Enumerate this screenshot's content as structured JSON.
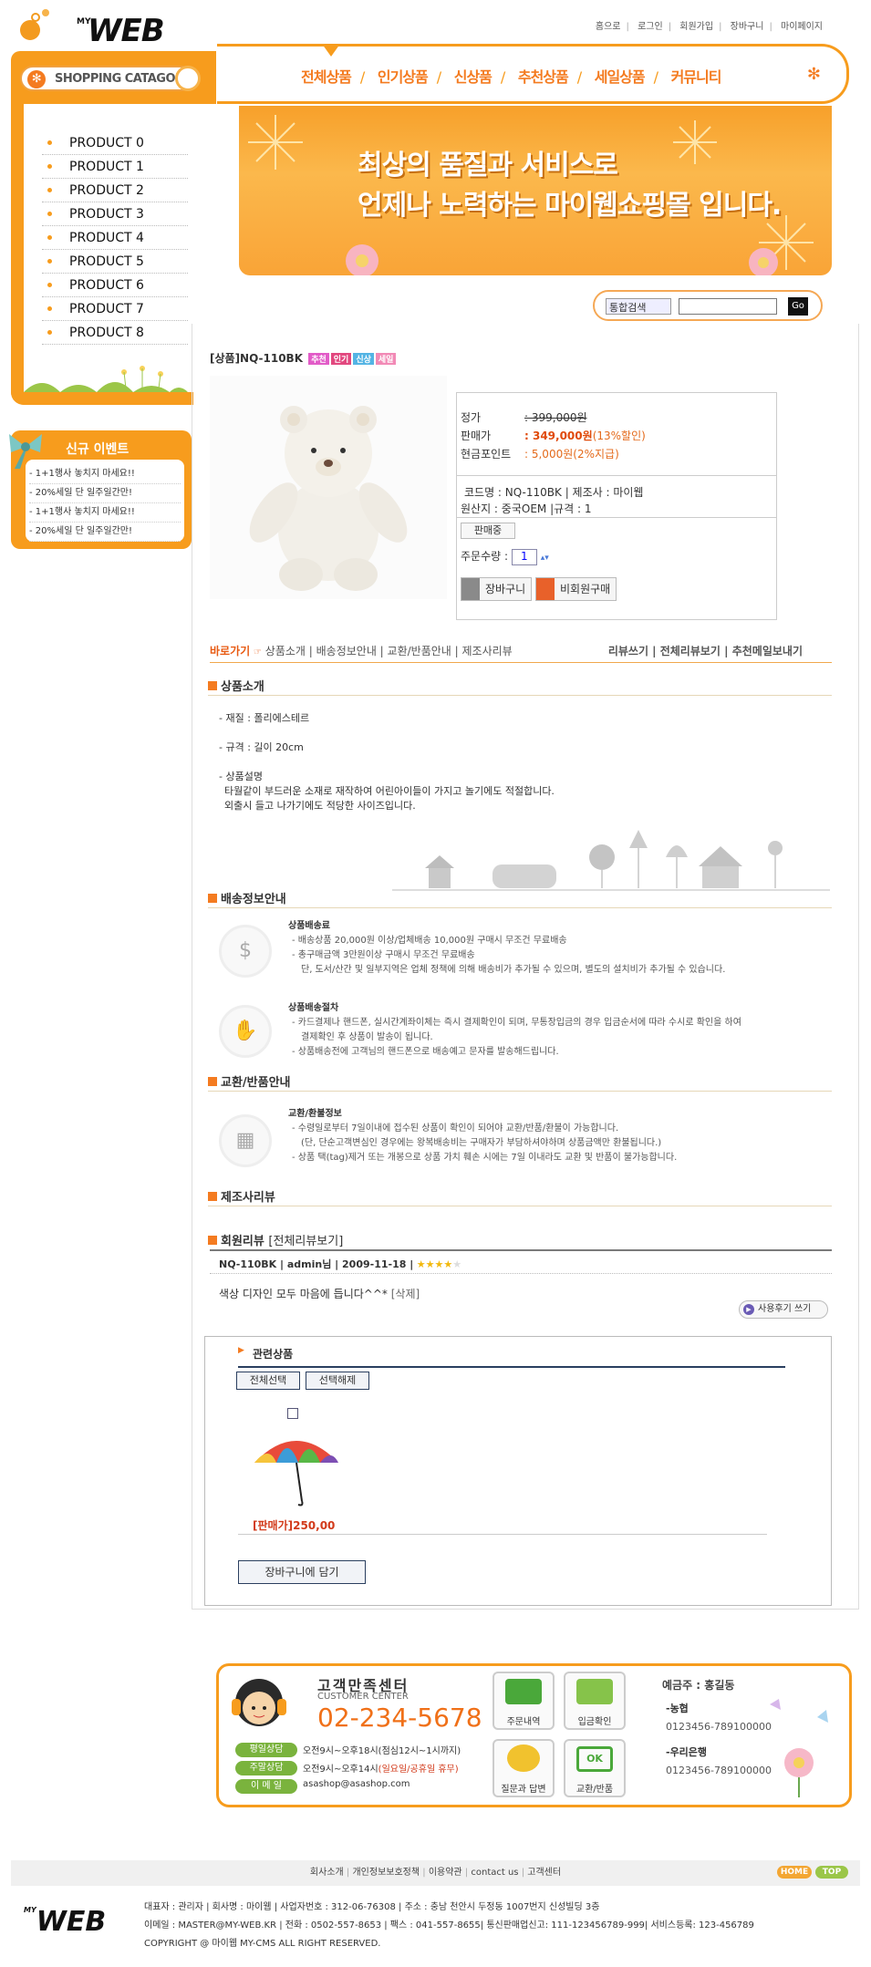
{
  "header": {
    "logo_my": "MY",
    "logo_text": "WEB",
    "top_links": [
      "홈으로",
      "로그인",
      "회원가입",
      "장바구니",
      "마이페이지"
    ]
  },
  "category": {
    "title": "SHOPPING CATAGORY",
    "items": [
      "PRODUCT 0",
      "PRODUCT 1",
      "PRODUCT 2",
      "PRODUCT 3",
      "PRODUCT 4",
      "PRODUCT 5",
      "PRODUCT 6",
      "PRODUCT 7",
      "PRODUCT 8"
    ]
  },
  "menu": [
    "전체상품",
    "인기상품",
    "신상품",
    "추천상품",
    "세일상품",
    "커뮤니티"
  ],
  "banner": {
    "line1": "최상의 품질과 서비스로",
    "line2": "언제나 노력하는 마이웹쇼핑몰 입니다."
  },
  "events": {
    "title": "신규 이벤트",
    "items": [
      "- 1+1행사 놓치지 마세요!!",
      "- 20%세일 단 일주일간만!",
      "- 1+1행사 놓치지 마세요!!",
      "- 20%세일 단 일주일간만!"
    ]
  },
  "search": {
    "select": "통합검색",
    "button": "Go"
  },
  "product": {
    "title": "[상품]NQ-110BK",
    "badges": [
      "추천",
      "인기",
      "신상",
      "세일"
    ],
    "price_label": "정가",
    "price": ": 399,000원",
    "sale_label": "판매가",
    "sale_price": ": 349,000원",
    "sale_pct": "(13%할인)",
    "point_label": "현금포인트",
    "point": ": 5,000원",
    "point_pct": "(2%지급)",
    "code_line": "코드명 : NQ-110BK | 제조사 : 마이웹",
    "origin_line": "원산지 : 중국OEM |규격 : 1",
    "status": "판매중",
    "qty_label": "주문수량 :",
    "qty": "1",
    "cart_btn": "장바구니",
    "buy_btn": "비회원구매"
  },
  "tabs": {
    "go": "바로가기",
    "left": "상품소개 | 배송정보안내 | 교환/반품안내 | 제조사리뷰",
    "right": "리뷰쓰기 | 전체리뷰보기 | 추천메일보내기"
  },
  "intro": {
    "head": "상품소개",
    "material": "- 재질 : 폴리에스테르",
    "size": "- 규격 : 길이 20cm",
    "desc_label": "- 상품설명",
    "desc1": "타월같이 부드러운 소재로 재작하여 어린아이들이 가지고 놀기에도 적절합니다.",
    "desc2": "외출시 들고 나가기에도 적당한 사이즈입니다."
  },
  "shipping": {
    "head": "배송정보안내",
    "fee_title": "상품배송료",
    "fee1": "- 배송상품 20,000원 이상/업체배송 10,000원 구매시 무조건 무료배송",
    "fee2": "- 총구매금액 3만원이상 구매시 무조건 무료배송",
    "fee3": "단, 도서/산간 및 일부지역은 업체 정책에 의해 배송비가 추가될 수 있으며, 별도의 설치비가 추가될 수 있습니다.",
    "proc_title": "상품배송절차",
    "proc1": "- 카드결제나 핸드폰, 실시간계좌이체는 즉시 결제확인이 되며, 무통장입금의 경우 입금순서에 따라 수시로 확인을 하여",
    "proc2": "결제확인 후 상품이 발송이 됩니다.",
    "proc3": "- 상품배송전에 고객님의 핸드폰으로 배송예고 문자를 발송해드립니다."
  },
  "exchange": {
    "head": "교환/반품안내",
    "title": "교환/환불정보",
    "l1": "- 수령일로부터 7일이내에 접수된 상품이 확인이 되어야 교환/반품/환불이 가능합니다.",
    "l2": "(단, 단순고객변심인 경우에는 왕복배송비는 구매자가 부담하셔야하며 상품금액만 환불됩니다.)",
    "l3": "- 상품 택(tag)제거 또는 개봉으로 상품 가치 훼손 시에는 7일 이내라도 교환 및 반품이 불가능합니다."
  },
  "maker_review": {
    "head": "제조사리뷰"
  },
  "member_review": {
    "head": "회원리뷰",
    "all": "[전체리뷰보기]",
    "meta": "NQ-110BK | admin님 | 2009-11-18 |",
    "stars_filled": 4,
    "stars_total": 5,
    "text": "색상 디자인 모두 마음에 듭니다^^*",
    "delete": "[삭제]",
    "write_btn": "사용후기 쓰기"
  },
  "related": {
    "head": "관련상품",
    "select_all": "전체선택",
    "deselect": "선택해제",
    "price": "[판매가]250,00",
    "cart_btn": "장바구니에 담기"
  },
  "cs": {
    "title": "고객만족센터",
    "sub": "CUSTOMER CENTER",
    "phone": "02-234-5678",
    "weekday_label": "평일상담",
    "weekday": "오전9시~오후18시(점심12시~1시까지)",
    "weekend_label": "주말상담",
    "weekend": "오전9시~오후14시",
    "weekend_note": "(일요일/공휴일 휴무)",
    "email_label": "이 메 일",
    "email": "asashop@asashop.com",
    "tiles": [
      "주문내역",
      "입금확인",
      "질문과 답변",
      "교환/반품"
    ],
    "bank_title": "예금주 : 홍길동",
    "bank1": "-농협",
    "acct1": "0123456-789100000",
    "bank2": "-우리은행",
    "acct2": "0123456-789100000"
  },
  "footer": {
    "links": [
      "회사소개",
      "개인정보보호정책",
      "이용약관",
      "contact us",
      "고객센터"
    ],
    "home": "HOME",
    "top": "TOP",
    "line1": "대표자 : 관리자 | 회사명 : 마이웹 | 사업자번호 : 312-06-76308 | 주소 : 충남 천안시 두정동 1007번지 신성빌딩 3층",
    "line2": "이메일 : MASTER@MY-WEB.KR | 전화 : 0502-557-8653 | 팩스 : 041-557-8655| 통신판매업신고: 111-123456789-999| 서비스등록: 123-456789",
    "line3": "COPYRIGHT @ 마이웹 MY-CMS ALL RIGHT RESERVED."
  }
}
